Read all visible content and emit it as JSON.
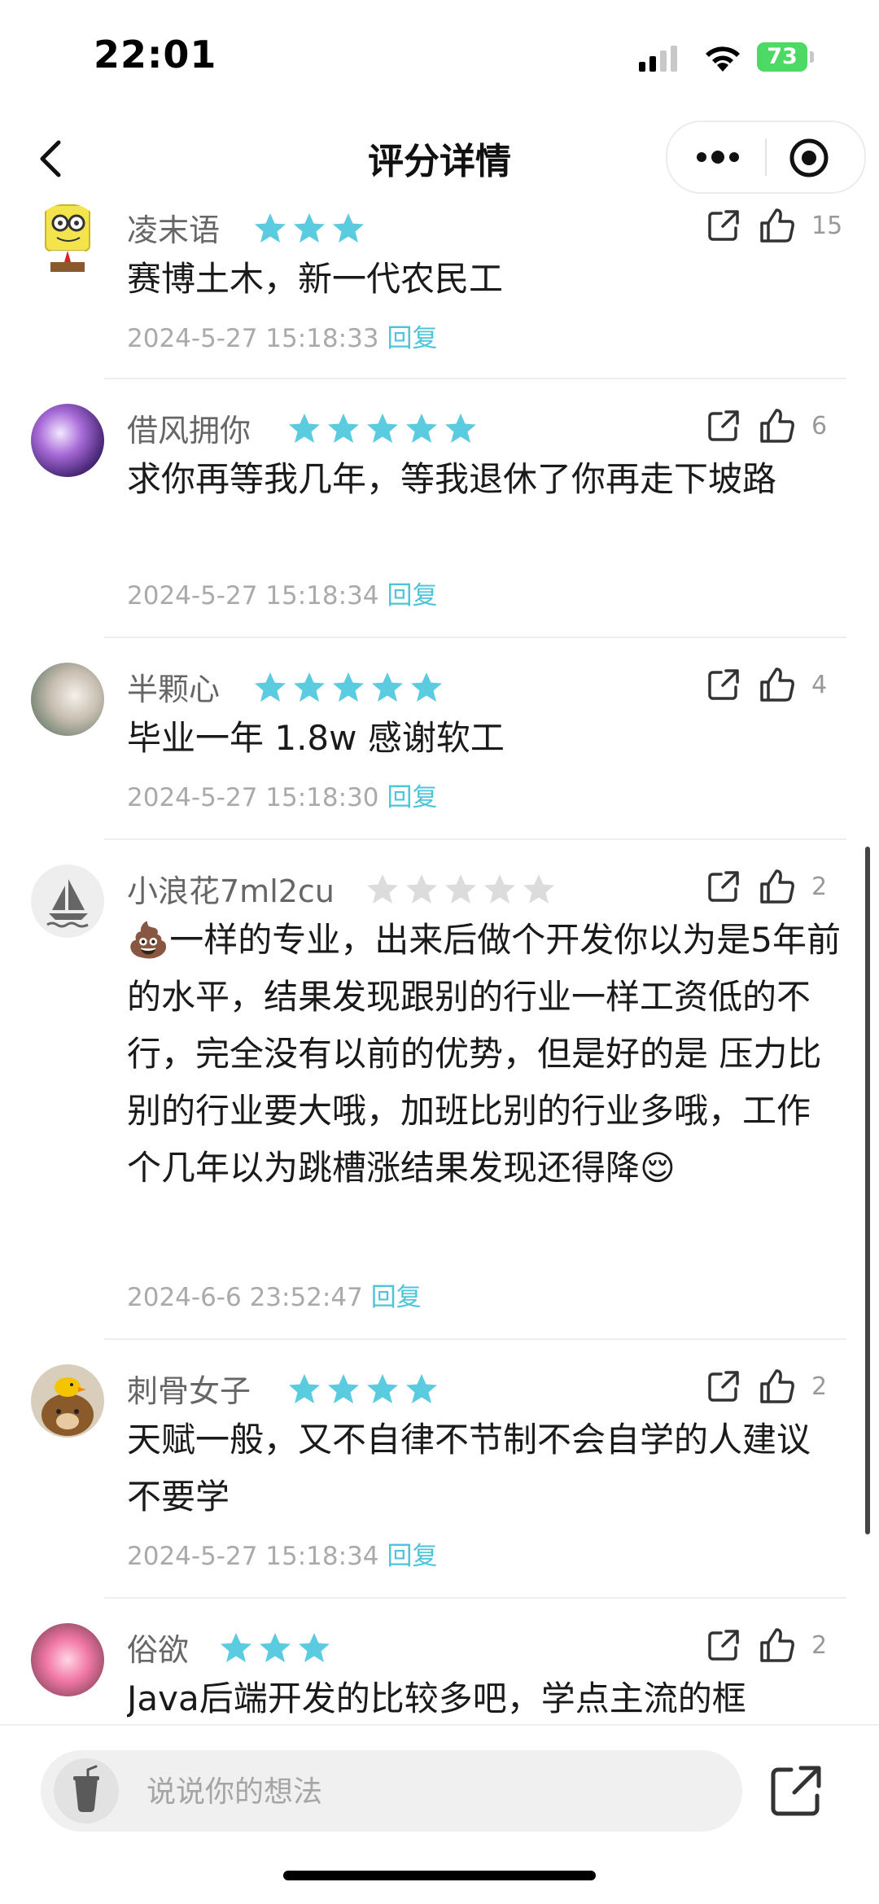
{
  "status_bar": {
    "time": "22:01",
    "battery": "73"
  },
  "nav": {
    "title": "评分详情"
  },
  "colors": {
    "star_active": "#5bcbe0",
    "star_inactive": "#dcdcdc",
    "reply": "#4ec4d8",
    "meta": "#aaaaaa"
  },
  "comments": [
    {
      "username": "凌末语",
      "rating": 3,
      "likes": "15",
      "content": "赛博土木，新一代农民工",
      "timestamp": "2024-5-27 15:18:33",
      "reply_label": "回复"
    },
    {
      "username": "借风拥你",
      "rating": 5,
      "likes": "6",
      "content": "求你再等我几年，等我退休了你再走下坡路",
      "timestamp": "2024-5-27 15:18:34",
      "reply_label": "回复"
    },
    {
      "username": "半颗心",
      "rating": 5,
      "likes": "4",
      "content": "毕业一年 1.8w 感谢软工",
      "timestamp": "2024-5-27 15:18:30",
      "reply_label": "回复"
    },
    {
      "username": "小浪花7ml2cu",
      "rating": 0,
      "likes": "2",
      "content": "💩一样的专业，出来后做个开发你以为是5年前的水平，结果发现跟别的行业一样工资低的不行，完全没有以前的优势，但是好的是 压力比别的行业要大哦，加班比别的行业多哦，工作个几年以为跳槽涨结果发现还得降😌",
      "timestamp": "2024-6-6 23:52:47",
      "reply_label": "回复"
    },
    {
      "username": "刺骨女子",
      "rating": 4,
      "likes": "2",
      "content": "天赋一般，又不自律不节制不会自学的人建议不要学",
      "timestamp": "2024-5-27 15:18:34",
      "reply_label": "回复"
    },
    {
      "username": "俗欲",
      "rating": 3,
      "likes": "2",
      "content": "Java后端开发的比较多吧，学点主流的框",
      "timestamp": "",
      "reply_label": ""
    }
  ],
  "bottom_bar": {
    "input_placeholder": "说说你的想法"
  }
}
